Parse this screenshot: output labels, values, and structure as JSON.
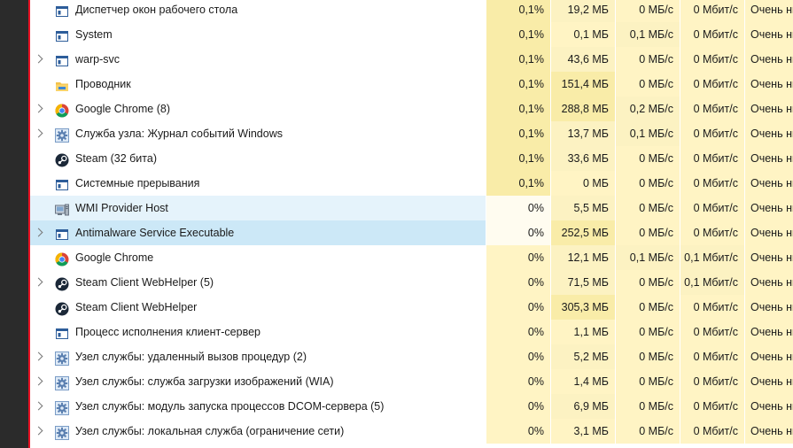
{
  "colors": {
    "name_bg": "#ffffff",
    "hover_bg": "#e5f3fb",
    "selected_bg": "#cce8f7",
    "heat_high": "#f9eca8",
    "heat_med": "#fcf2c2",
    "heat_low": "#fff4c4",
    "heat_none": "#fffcf0",
    "accent_red": "#e81123"
  },
  "processes": [
    {
      "name": "Диспетчер окон рабочего стола",
      "icon": "window-icon",
      "expandable": false,
      "cpu": "0,1%",
      "mem": "19,2 МБ",
      "disk": "0 МБ/с",
      "net": "0 Мбит/с",
      "power": "Очень ни",
      "heat": [
        "high",
        "med",
        "low",
        "low",
        "low"
      ]
    },
    {
      "name": "System",
      "icon": "window-icon",
      "expandable": false,
      "cpu": "0,1%",
      "mem": "0,1 МБ",
      "disk": "0,1 МБ/с",
      "net": "0 Мбит/с",
      "power": "Очень ни",
      "heat": [
        "high",
        "low",
        "med",
        "low",
        "low"
      ]
    },
    {
      "name": "warp-svc",
      "icon": "window-icon",
      "expandable": true,
      "cpu": "0,1%",
      "mem": "43,6 МБ",
      "disk": "0 МБ/с",
      "net": "0 Мбит/с",
      "power": "Очень ни",
      "heat": [
        "high",
        "med",
        "low",
        "low",
        "low"
      ]
    },
    {
      "name": "Проводник",
      "icon": "folder-icon",
      "expandable": false,
      "cpu": "0,1%",
      "mem": "151,4 МБ",
      "disk": "0 МБ/с",
      "net": "0 Мбит/с",
      "power": "Очень ни",
      "heat": [
        "high",
        "high",
        "low",
        "low",
        "low"
      ]
    },
    {
      "name": "Google Chrome (8)",
      "icon": "chrome-icon",
      "expandable": true,
      "cpu": "0,1%",
      "mem": "288,8 МБ",
      "disk": "0,2 МБ/с",
      "net": "0 Мбит/с",
      "power": "Очень ни",
      "heat": [
        "high",
        "high",
        "med",
        "low",
        "low"
      ]
    },
    {
      "name": "Служба узла: Журнал событий Windows",
      "icon": "gear-icon",
      "expandable": true,
      "cpu": "0,1%",
      "mem": "13,7 МБ",
      "disk": "0,1 МБ/с",
      "net": "0 Мбит/с",
      "power": "Очень ни",
      "heat": [
        "high",
        "med",
        "med",
        "low",
        "low"
      ]
    },
    {
      "name": "Steam (32 бита)",
      "icon": "steam-icon",
      "expandable": false,
      "cpu": "0,1%",
      "mem": "33,6 МБ",
      "disk": "0 МБ/с",
      "net": "0 Мбит/с",
      "power": "Очень ни",
      "heat": [
        "high",
        "med",
        "low",
        "low",
        "low"
      ]
    },
    {
      "name": "Системные прерывания",
      "icon": "window-icon",
      "expandable": false,
      "cpu": "0,1%",
      "mem": "0 МБ",
      "disk": "0 МБ/с",
      "net": "0 Мбит/с",
      "power": "Очень ни",
      "heat": [
        "high",
        "low",
        "low",
        "low",
        "low"
      ]
    },
    {
      "name": "WMI Provider Host",
      "icon": "wmi-host-icon",
      "expandable": false,
      "state": "hover",
      "cpu": "0%",
      "mem": "5,5 МБ",
      "disk": "0 МБ/с",
      "net": "0 Мбит/с",
      "power": "Очень ни",
      "heat": [
        "none",
        "med",
        "low",
        "low",
        "low"
      ]
    },
    {
      "name": "Antimalware Service Executable",
      "icon": "window-icon",
      "expandable": true,
      "state": "selected",
      "cpu": "0%",
      "mem": "252,5 МБ",
      "disk": "0 МБ/с",
      "net": "0 Мбит/с",
      "power": "Очень ни",
      "heat": [
        "none",
        "high",
        "low",
        "low",
        "low"
      ]
    },
    {
      "name": "Google Chrome",
      "icon": "chrome-icon",
      "expandable": false,
      "cpu": "0%",
      "mem": "12,1 МБ",
      "disk": "0,1 МБ/с",
      "net": "0,1 Мбит/с",
      "power": "Очень ни",
      "heat": [
        "low",
        "med",
        "med",
        "med",
        "low"
      ]
    },
    {
      "name": "Steam Client WebHelper (5)",
      "icon": "steam-icon",
      "expandable": true,
      "cpu": "0%",
      "mem": "71,5 МБ",
      "disk": "0 МБ/с",
      "net": "0,1 Мбит/с",
      "power": "Очень ни",
      "heat": [
        "low",
        "med",
        "low",
        "med",
        "low"
      ]
    },
    {
      "name": "Steam Client WebHelper",
      "icon": "steam-icon",
      "expandable": false,
      "cpu": "0%",
      "mem": "305,3 МБ",
      "disk": "0 МБ/с",
      "net": "0 Мбит/с",
      "power": "Очень ни",
      "heat": [
        "low",
        "high",
        "low",
        "low",
        "low"
      ]
    },
    {
      "name": "Процесс исполнения клиент-сервер",
      "icon": "window-icon",
      "expandable": false,
      "cpu": "0%",
      "mem": "1,1 МБ",
      "disk": "0 МБ/с",
      "net": "0 Мбит/с",
      "power": "Очень ни",
      "heat": [
        "low",
        "low",
        "low",
        "low",
        "low"
      ]
    },
    {
      "name": "Узел службы: удаленный вызов процедур (2)",
      "icon": "gear-icon",
      "expandable": true,
      "cpu": "0%",
      "mem": "5,2 МБ",
      "disk": "0 МБ/с",
      "net": "0 Мбит/с",
      "power": "Очень ни",
      "heat": [
        "low",
        "med",
        "low",
        "low",
        "low"
      ]
    },
    {
      "name": "Узел службы: служба загрузки изображений (WIA)",
      "icon": "gear-icon",
      "expandable": true,
      "cpu": "0%",
      "mem": "1,4 МБ",
      "disk": "0 МБ/с",
      "net": "0 Мбит/с",
      "power": "Очень ни",
      "heat": [
        "low",
        "low",
        "low",
        "low",
        "low"
      ]
    },
    {
      "name": "Узел службы: модуль запуска процессов DCOM-сервера (5)",
      "icon": "gear-icon",
      "expandable": true,
      "cpu": "0%",
      "mem": "6,9 МБ",
      "disk": "0 МБ/с",
      "net": "0 Мбит/с",
      "power": "Очень ни",
      "heat": [
        "low",
        "med",
        "low",
        "low",
        "low"
      ]
    },
    {
      "name": "Узел службы: локальная служба (ограничение сети)",
      "icon": "gear-icon",
      "expandable": true,
      "cpu": "0%",
      "mem": "3,1 МБ",
      "disk": "0 МБ/с",
      "net": "0 Мбит/с",
      "power": "Очень ни",
      "heat": [
        "low",
        "low",
        "low",
        "low",
        "low"
      ]
    }
  ]
}
